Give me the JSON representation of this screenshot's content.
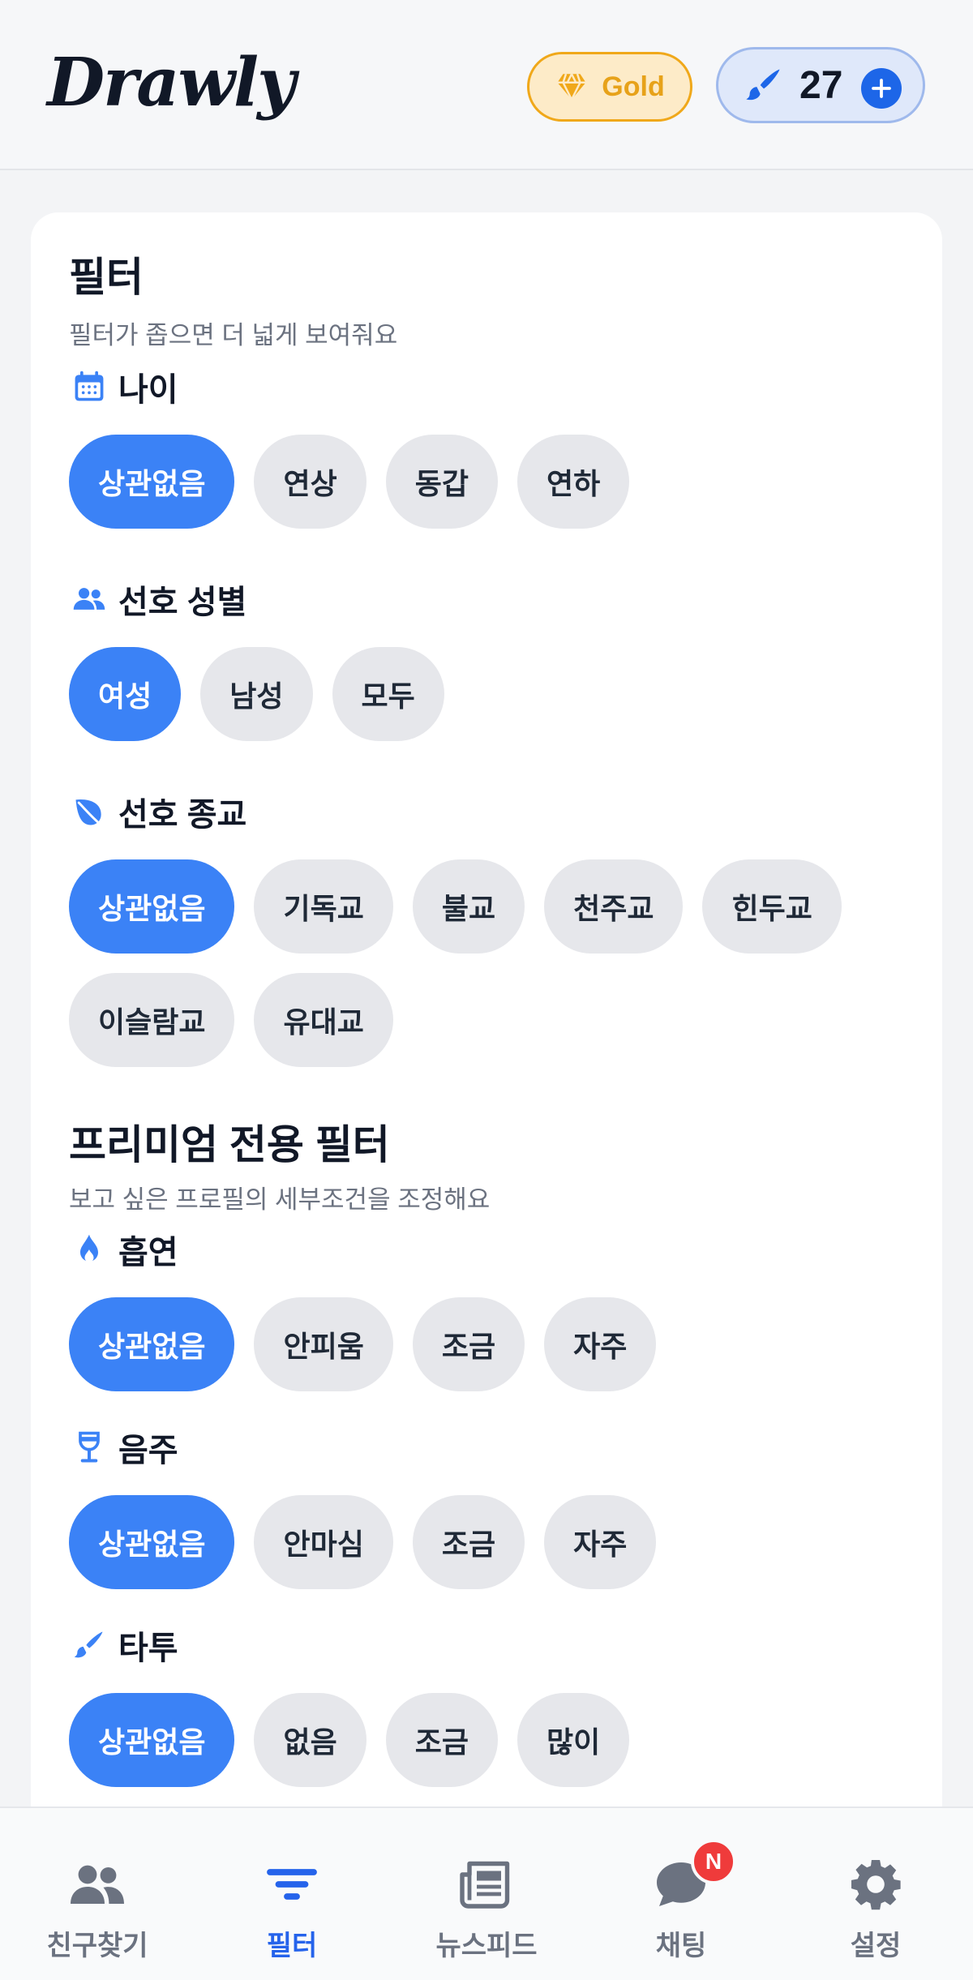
{
  "header": {
    "logo": "Drawly",
    "membership_label": "Gold",
    "brush_count": "27",
    "colors": {
      "gold": "#f0a81a",
      "accent": "#1d66e8"
    }
  },
  "card": {
    "title": "필터",
    "subtitle": "필터가 좁으면 더 넓게 보여줘요",
    "premium_title": "프리미엄 전용 필터",
    "premium_subtitle": "보고 싶은 프로필의 세부조건을 조정해요",
    "groups": {
      "age": {
        "label": "나이",
        "icon": "calendar-icon",
        "options": [
          "상관없음",
          "연상",
          "동갑",
          "연하"
        ],
        "selected": "상관없음"
      },
      "gender": {
        "label": "선호 성별",
        "icon": "users-icon",
        "options": [
          "여성",
          "남성",
          "모두"
        ],
        "selected": "여성"
      },
      "religion": {
        "label": "선호 종교",
        "icon": "leaf-icon",
        "options": [
          "상관없음",
          "기독교",
          "불교",
          "천주교",
          "힌두교",
          "이슬람교",
          "유대교"
        ],
        "selected": "상관없음"
      },
      "smoking": {
        "label": "흡연",
        "icon": "flame-icon",
        "options": [
          "상관없음",
          "안피움",
          "조금",
          "자주"
        ],
        "selected": "상관없음"
      },
      "drinking": {
        "label": "음주",
        "icon": "wine-glass-icon",
        "options": [
          "상관없음",
          "안마심",
          "조금",
          "자주"
        ],
        "selected": "상관없음"
      },
      "tattoo": {
        "label": "타투",
        "icon": "brush-icon",
        "options": [
          "상관없음",
          "없음",
          "조금",
          "많이"
        ],
        "selected": "상관없음"
      }
    },
    "colors": {
      "chip_active": "#3b82f6",
      "chip_inactive": "#e6e7eb"
    }
  },
  "nav": {
    "items": [
      {
        "label": "친구찾기",
        "icon": "users-icon"
      },
      {
        "label": "필터",
        "icon": "filter-icon",
        "active": true
      },
      {
        "label": "뉴스피드",
        "icon": "newspaper-icon"
      },
      {
        "label": "채팅",
        "icon": "chat-bubble-icon",
        "badge": "N"
      },
      {
        "label": "설정",
        "icon": "gear-icon"
      }
    ]
  }
}
